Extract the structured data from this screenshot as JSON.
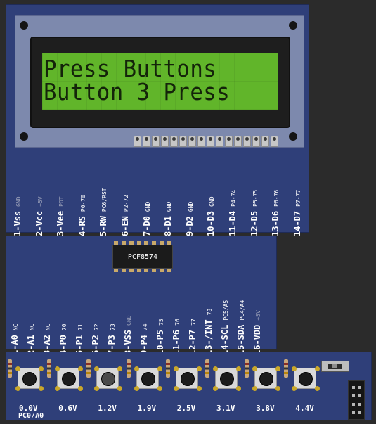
{
  "lcd": {
    "line1": "Press Buttons",
    "line2": "Button 3 Press"
  },
  "lcd_pins": [
    {
      "name": "1-Vss",
      "sub": "GND",
      "sub_dim": true
    },
    {
      "name": "2-Vcc",
      "sub": "+5V",
      "sub_dim": true
    },
    {
      "name": "3-Vee",
      "sub": "POT",
      "sub_dim": true
    },
    {
      "name": "4-RS",
      "sub": "P0-70",
      "sub_dim": false
    },
    {
      "name": "5-RW",
      "sub": "PC6/RST",
      "sub_dim": false
    },
    {
      "name": "6-EN",
      "sub": "P2-72",
      "sub_dim": false
    },
    {
      "name": "7-D0",
      "sub": "GND",
      "sub_dim": false
    },
    {
      "name": "8-D1",
      "sub": "GND",
      "sub_dim": false
    },
    {
      "name": "9-D2",
      "sub": "GND",
      "sub_dim": false
    },
    {
      "name": "10-D3",
      "sub": "GND",
      "sub_dim": false
    },
    {
      "name": "11-D4",
      "sub": "P4-74",
      "sub_dim": false
    },
    {
      "name": "12-D5",
      "sub": "P5-75",
      "sub_dim": false
    },
    {
      "name": "13-D6",
      "sub": "P6-76",
      "sub_dim": false
    },
    {
      "name": "14-D7",
      "sub": "P7-77",
      "sub_dim": false
    }
  ],
  "chip": {
    "label": "PCF8574"
  },
  "chip_pins": [
    {
      "name": "1-A0",
      "sub": "NC",
      "sub_dim": false
    },
    {
      "name": "2-A1",
      "sub": "NC",
      "sub_dim": false
    },
    {
      "name": "3-A2",
      "sub": "NC",
      "sub_dim": false
    },
    {
      "name": "4-P0",
      "sub": "70",
      "sub_dim": false
    },
    {
      "name": "5-P1",
      "sub": "71",
      "sub_dim": false
    },
    {
      "name": "6-P2",
      "sub": "72",
      "sub_dim": false
    },
    {
      "name": "7-P3",
      "sub": "73",
      "sub_dim": false
    },
    {
      "name": "8-VSS",
      "sub": "GND",
      "sub_dim": true
    },
    {
      "name": "9-P4",
      "sub": "74",
      "sub_dim": false
    },
    {
      "name": "10-P5",
      "sub": "75",
      "sub_dim": false
    },
    {
      "name": "11-P6",
      "sub": "76",
      "sub_dim": false
    },
    {
      "name": "12-P7",
      "sub": "77",
      "sub_dim": false
    },
    {
      "name": "13-/INT",
      "sub": "78",
      "sub_dim": false
    },
    {
      "name": "14-SCL",
      "sub": "PC5/A5",
      "sub_dim": false
    },
    {
      "name": "15-SDA",
      "sub": "PC4/A4",
      "sub_dim": false
    },
    {
      "name": "16-VDD",
      "sub": "+5V",
      "sub_dim": true
    }
  ],
  "buttons": [
    {
      "voltage": "0.0V",
      "pressed": false
    },
    {
      "voltage": "0.6V",
      "pressed": false
    },
    {
      "voltage": "1.2V",
      "pressed": true
    },
    {
      "voltage": "1.9V",
      "pressed": false
    },
    {
      "voltage": "2.5V",
      "pressed": false
    },
    {
      "voltage": "3.1V",
      "pressed": false
    },
    {
      "voltage": "3.8V",
      "pressed": false
    },
    {
      "voltage": "4.4V",
      "pressed": false
    }
  ],
  "button_port": "PC0/A0"
}
